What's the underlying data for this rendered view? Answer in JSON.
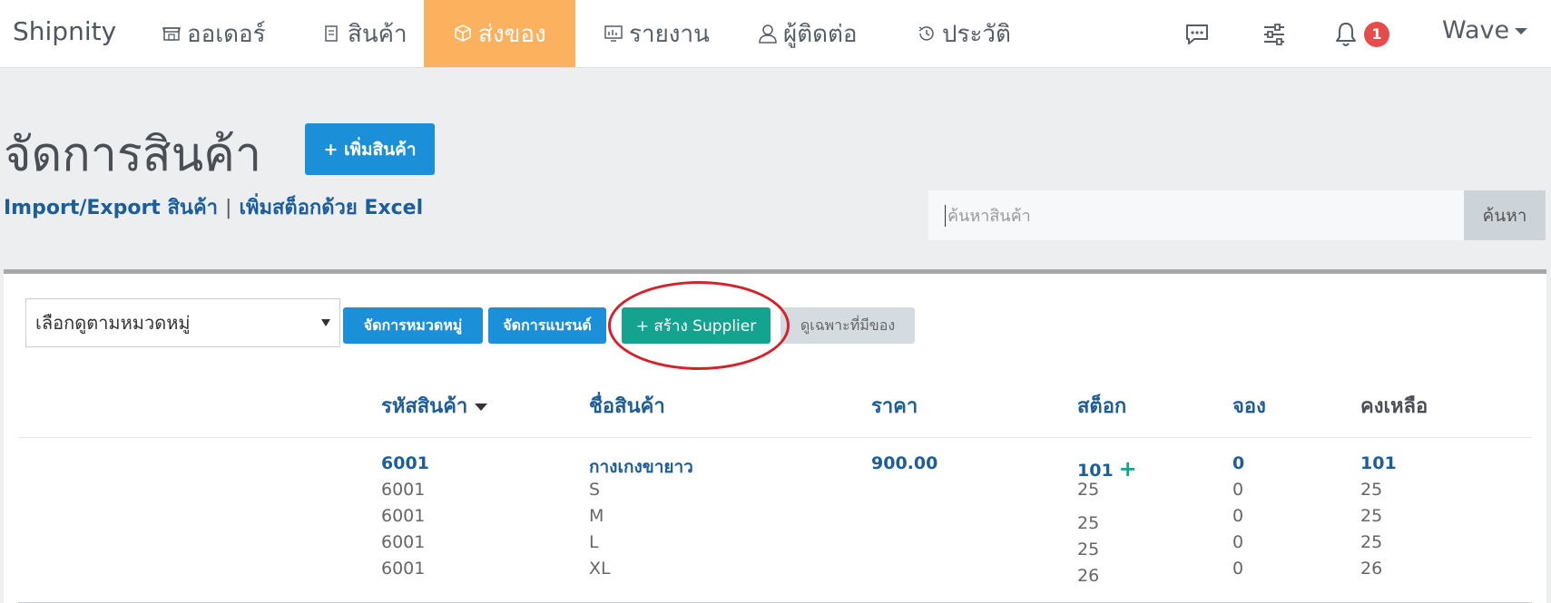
{
  "nav": {
    "brand": "Shipnity",
    "items": [
      {
        "label": "ออเดอร์",
        "icon": "store-icon"
      },
      {
        "label": "สินค้า",
        "icon": "product-tag-icon"
      },
      {
        "label": "ส่งของ",
        "icon": "box-icon",
        "active": true
      },
      {
        "label": "รายงาน",
        "icon": "chart-icon"
      },
      {
        "label": "ผู้ติดต่อ",
        "icon": "user-icon"
      },
      {
        "label": "ประวัติ",
        "icon": "history-icon"
      }
    ],
    "notification_count": "1",
    "user": "Wave"
  },
  "header": {
    "title": "จัดการสินค้า",
    "add_button": "+ เพิ่มสินค้า",
    "link_import": "Import/Export สินค้า",
    "link_separator": "|",
    "link_excel": "เพิ่มสต็อกด้วย Excel",
    "search_placeholder": "ค้นหาสินค้า",
    "search_button": "ค้นหา"
  },
  "toolbar": {
    "category_select": "เลือกดูตามหมวดหมู่",
    "manage_category": "จัดการหมวดหมู่",
    "manage_brand": "จัดการแบรนด์",
    "create_supplier": "+ สร้าง Supplier",
    "in_stock_only": "ดูเฉพาะที่มีของ"
  },
  "table": {
    "columns": [
      "รหัสสินค้า",
      "ชื่อสินค้า",
      "ราคา",
      "สต็อก",
      "จอง",
      "คงเหลือ"
    ],
    "product": {
      "code": "6001",
      "name": "กางเกงขายาว",
      "price": "900.00",
      "stock": "101",
      "reserved": "0",
      "remaining": "101"
    },
    "variants": [
      {
        "code": "6001",
        "name": "S",
        "stock": "25",
        "reserved": "0",
        "remaining": "25"
      },
      {
        "code": "6001",
        "name": "M",
        "stock": "25",
        "reserved": "0",
        "remaining": "25"
      },
      {
        "code": "6001",
        "name": "L",
        "stock": "25",
        "reserved": "0",
        "remaining": "25"
      },
      {
        "code": "6001",
        "name": "XL",
        "stock": "26",
        "reserved": "0",
        "remaining": "26"
      }
    ]
  },
  "colors": {
    "accent_orange": "#fbb15d",
    "primary_blue": "#1b8fd8",
    "green": "#13a38f",
    "link": "#1d5e99",
    "highlight_circle": "#d7202a"
  }
}
